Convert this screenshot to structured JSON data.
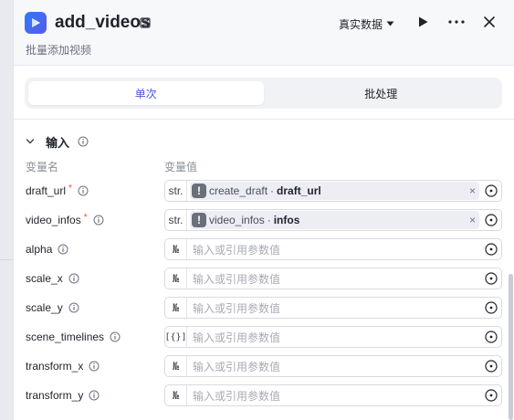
{
  "header": {
    "title": "add_videos",
    "subtitle": "批量添加视频",
    "data_source": "真实数据"
  },
  "mode_tabs": [
    {
      "label": "单次",
      "active": true
    },
    {
      "label": "批处理",
      "active": false
    }
  ],
  "input_section": {
    "title": "输入",
    "col_name": "变量名",
    "col_value": "变量值"
  },
  "params": [
    {
      "name": "draft_url",
      "required": true,
      "type": "str.",
      "ref_node": "create_draft",
      "ref_field": "draft_url"
    },
    {
      "name": "video_infos",
      "required": true,
      "type": "str.",
      "ref_node": "video_infos",
      "ref_field": "infos"
    },
    {
      "name": "alpha",
      "required": false,
      "type": "№",
      "placeholder": "输入或引用参数值"
    },
    {
      "name": "scale_x",
      "required": false,
      "type": "№",
      "placeholder": "输入或引用参数值"
    },
    {
      "name": "scale_y",
      "required": false,
      "type": "№",
      "placeholder": "输入或引用参数值"
    },
    {
      "name": "scene_timelines",
      "required": false,
      "type": "[{}]",
      "placeholder": "输入或引用参数值"
    },
    {
      "name": "transform_x",
      "required": false,
      "type": "№",
      "placeholder": "输入或引用参数值"
    },
    {
      "name": "transform_y",
      "required": false,
      "type": "№",
      "placeholder": "输入或引用参数值"
    }
  ],
  "colors": {
    "accent": "#4d53e8",
    "required": "#f0483e",
    "logo_start": "#2c7bf6",
    "logo_end": "#5b58ee"
  }
}
